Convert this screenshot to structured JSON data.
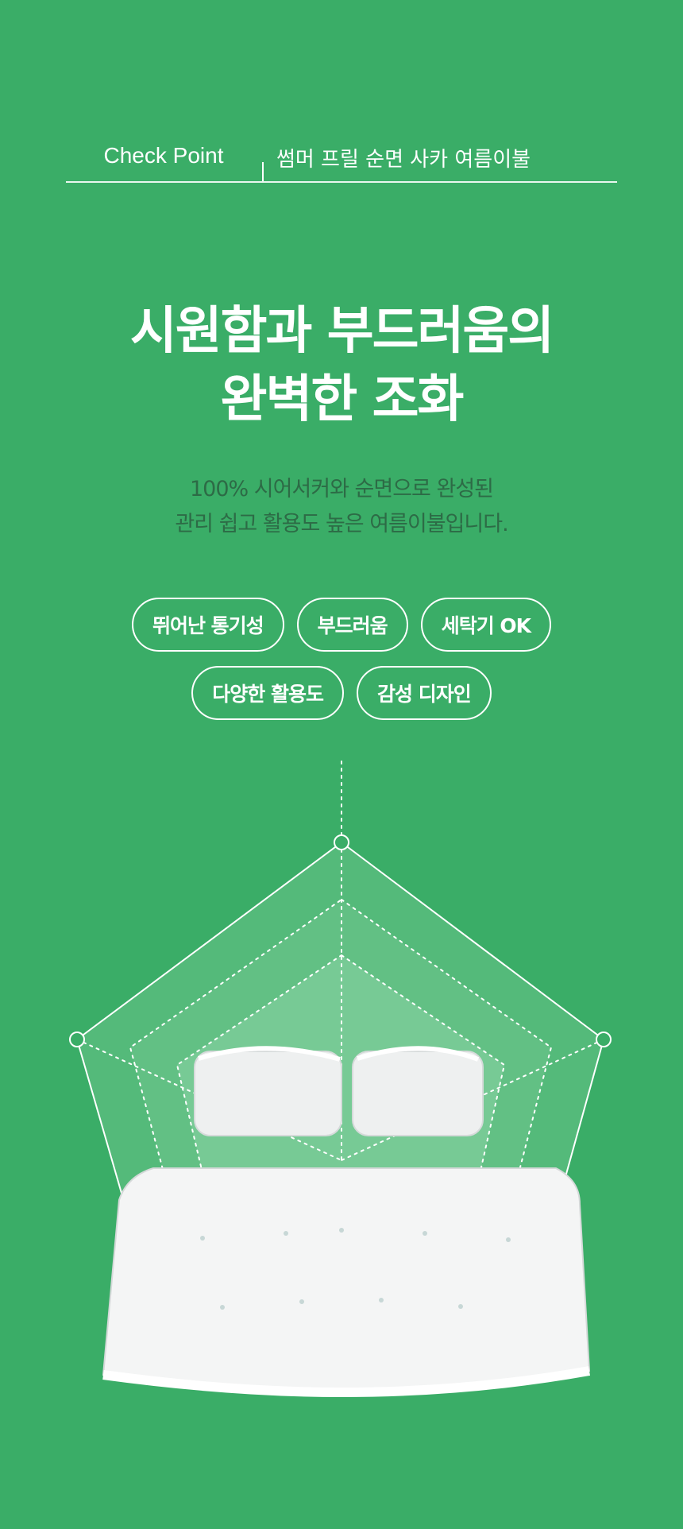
{
  "header": {
    "left_label": "Check Point",
    "right_label": "썸머 프릴 순면 사카 여름이불"
  },
  "hero": {
    "title_line_1": "시원함과 부드러움의",
    "title_line_2": "완벽한 조화",
    "subtitle_line_1": "100% 시어서커와 순면으로 완성된",
    "subtitle_line_2": "관리 쉽고 활용도 높은 여름이불입니다."
  },
  "badges": [
    {
      "label": "뛰어난 통기성"
    },
    {
      "label": "부드러움"
    },
    {
      "label": "세탁기 OK"
    },
    {
      "label": "다양한 활용도"
    },
    {
      "label": "감성 디자인"
    }
  ],
  "colors": {
    "background": "#3aad67",
    "white": "#ffffff",
    "subtitle": "#2d6b46"
  }
}
